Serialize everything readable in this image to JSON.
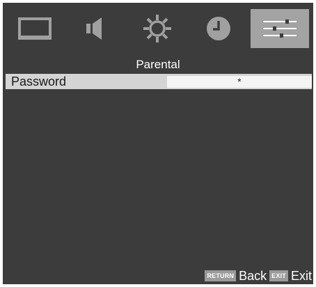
{
  "tabs": [
    {
      "id": "picture",
      "icon": "monitor-icon",
      "active": false
    },
    {
      "id": "sound",
      "icon": "speaker-icon",
      "active": false
    },
    {
      "id": "setup",
      "icon": "gear-icon",
      "active": false
    },
    {
      "id": "time",
      "icon": "clock-icon",
      "active": false
    },
    {
      "id": "parental",
      "icon": "sliders-icon",
      "active": true
    }
  ],
  "colors": {
    "background": "#3c3c3c",
    "icon": "#a0a0a0",
    "active_tab": "#a3a3a3",
    "selected_row": "#d4d4d4"
  },
  "section": {
    "title": "Parental"
  },
  "rows": [
    {
      "label": "Password",
      "value": "*"
    }
  ],
  "footer": {
    "return_key": "RETURN",
    "return_label": "Back",
    "exit_key": "EXIT",
    "exit_label": "Exit"
  }
}
